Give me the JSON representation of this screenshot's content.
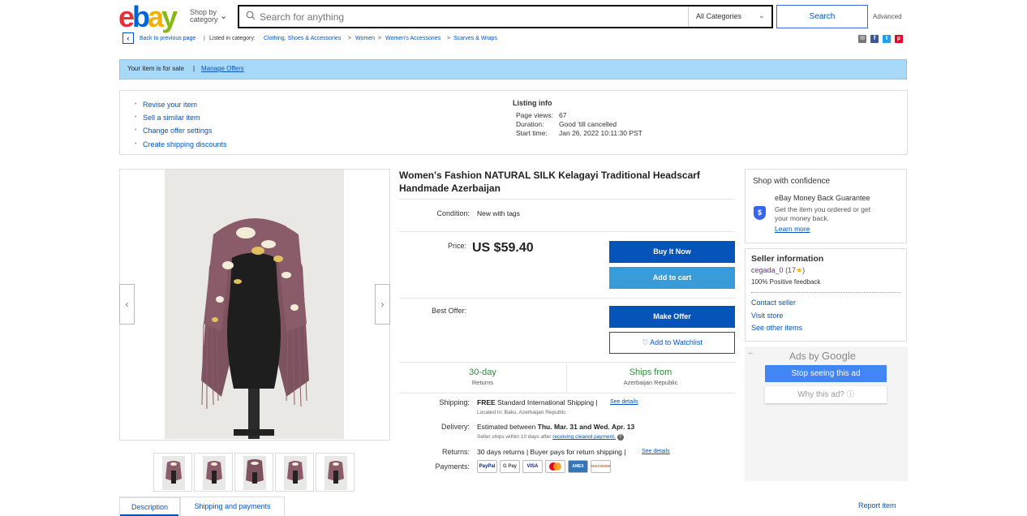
{
  "header": {
    "logo": {
      "e": "e",
      "b": "b",
      "a": "a",
      "y": "y"
    },
    "shop_by_line1": "Shop by",
    "shop_by_line2": "category",
    "search_placeholder": "Search for anything",
    "category_select": "All Categories",
    "search_button": "Search",
    "advanced": "Advanced"
  },
  "breadcrumb": {
    "back": "Back to previous page",
    "listed_in": "Listed in category:",
    "items": [
      "Clothing, Shoes & Accessories",
      "Women",
      "Women's Accessories",
      "Scarves & Wraps"
    ],
    "sep": ">"
  },
  "share_icons": [
    "email-icon",
    "facebook-icon",
    "twitter-icon",
    "pinterest-icon"
  ],
  "banner": {
    "text": "Your item is for sale",
    "sep": "|",
    "link": "Manage Offers"
  },
  "actions": [
    "Revise your item",
    "Sell a similar item",
    "Change offer settings",
    "Create shipping discounts"
  ],
  "listing_info": {
    "title": "Listing info",
    "rows": [
      {
        "label": "Page views:",
        "value": "67"
      },
      {
        "label": "Duration:",
        "value": "Good 'till cancelled"
      },
      {
        "label": "Start time:",
        "value": "Jan 26, 2022 10:11:30 PST"
      }
    ]
  },
  "gallery": {
    "prev": "‹",
    "next": "›",
    "thumb_count": 5
  },
  "product": {
    "title": "Women's Fashion NATURAL SILK Kelagayi Traditional Headscarf Handmade Azerbaijan",
    "condition_label": "Condition:",
    "condition_value": "New with tags",
    "price_label": "Price:",
    "price": "US $59.40",
    "buy_now": "Buy It Now",
    "add_to_cart": "Add to cart",
    "best_offer_label": "Best Offer:",
    "make_offer": "Make Offer",
    "watchlist": "♡ Add to Watchlist",
    "returns_big": "30-day",
    "returns_small": "Returns",
    "ships_big": "Ships from",
    "ships_small": "Azerbaijan Republic",
    "shipping_label": "Shipping:",
    "shipping_free": "FREE",
    "shipping_value": "Standard International Shipping |",
    "shipping_link": "See details",
    "located_in": "Located in:  Baku, Azerbaijan Republic",
    "delivery_label": "Delivery:",
    "delivery_value_pre": "Estimated between",
    "delivery_value_dates": "Thu. Mar. 31 and Wed. Apr. 13",
    "delivery_note_pre": "Seller ships within 10 days after",
    "delivery_note_link": "receiving cleared payment.",
    "returns_label": "Returns:",
    "returns_value": "30 days returns | Buyer pays for return shipping |",
    "returns_link": "See details",
    "payments_label": "Payments:",
    "payments": [
      "PayPal",
      "G Pay",
      "VISA",
      "MC",
      "AMEX",
      "DISCOVER"
    ]
  },
  "confidence": {
    "title": "Shop with confidence",
    "guarantee": "eBay Money Back Guarantee",
    "desc1": "Get the item you ordered or get",
    "desc2": "your money back.",
    "learn_more": "Learn more"
  },
  "seller": {
    "title": "Seller information",
    "name": "cegada_0",
    "score": "(17",
    "score_end": ")",
    "feedback": "100% Positive feedback",
    "contact": "Contact seller",
    "visit": "Visit store",
    "other": "See other items"
  },
  "ads": {
    "ads_by": "Ads by",
    "google": "Google",
    "stop": "Stop seeing this ad",
    "why": "Why this ad?"
  },
  "tabs": [
    "Description",
    "Shipping and payments"
  ],
  "report": "Report item",
  "colors": {
    "accent": "#0654ba",
    "banner": "#a9d9f8",
    "green": "#2e8b3a"
  }
}
